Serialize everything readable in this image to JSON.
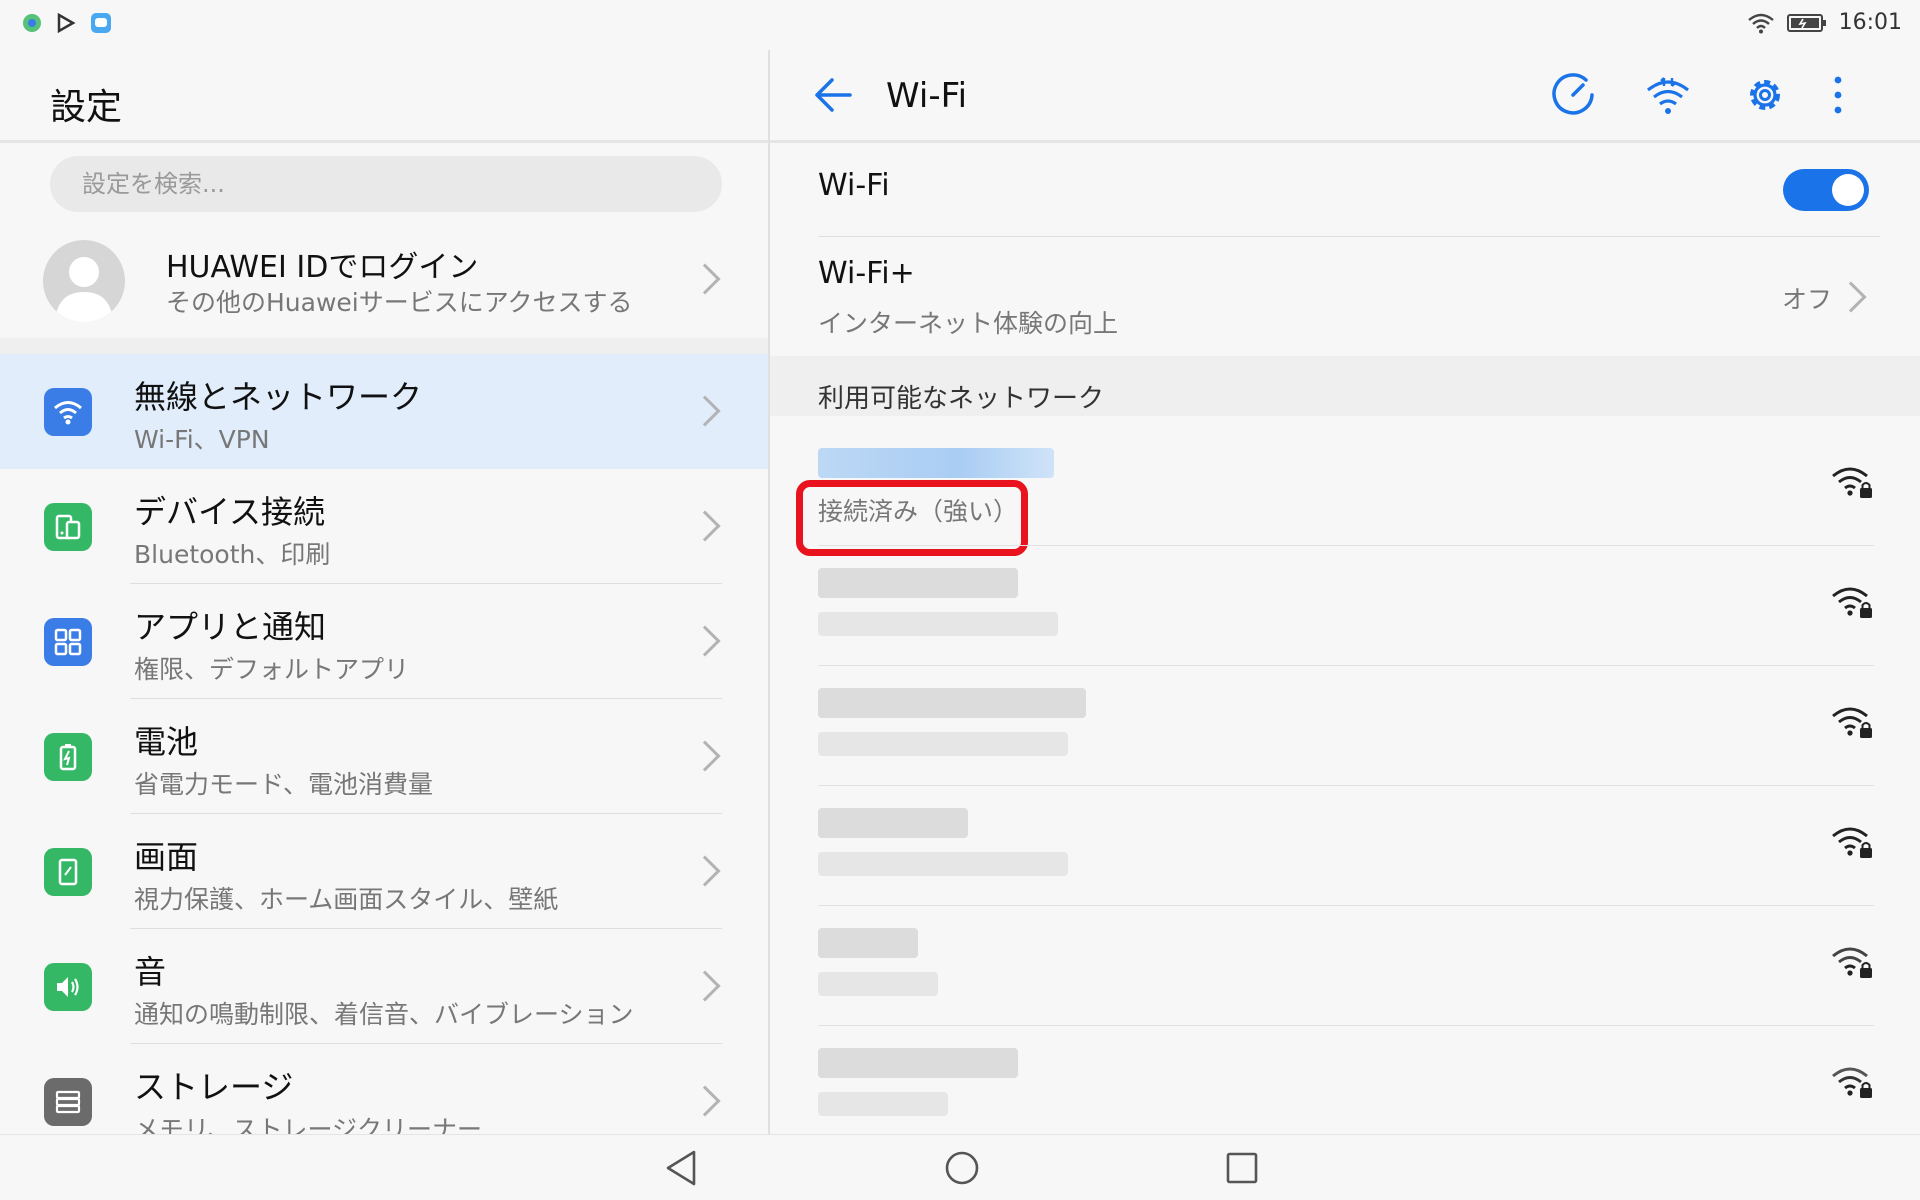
{
  "status_bar": {
    "time": "16:01"
  },
  "left": {
    "title": "設定",
    "search_placeholder": "設定を検索...",
    "account": {
      "title": "HUAWEI IDでログイン",
      "subtitle": "その他のHuaweiサービスにアクセスする"
    },
    "items": [
      {
        "title": "無線とネットワーク",
        "subtitle": "Wi-Fi、VPN",
        "icon": "wifi-icon",
        "color": "#3b7de6",
        "selected": true
      },
      {
        "title": "デバイス接続",
        "subtitle": "Bluetooth、印刷",
        "icon": "device-connect-icon",
        "color": "#35b865"
      },
      {
        "title": "アプリと通知",
        "subtitle": "権限、デフォルトアプリ",
        "icon": "apps-grid-icon",
        "color": "#3b7de6"
      },
      {
        "title": "電池",
        "subtitle": "省電力モード、電池消費量",
        "icon": "battery-icon",
        "color": "#35b865"
      },
      {
        "title": "画面",
        "subtitle": "視力保護、ホーム画面スタイル、壁紙",
        "icon": "display-icon",
        "color": "#35b865"
      },
      {
        "title": "音",
        "subtitle": "通知の鳴動制限、着信音、バイブレーション",
        "icon": "speaker-icon",
        "color": "#35b865"
      },
      {
        "title": "ストレージ",
        "subtitle": "メモリ、ストレージクリーナー",
        "icon": "storage-icon",
        "color": "#6b6b6b"
      }
    ]
  },
  "right": {
    "title": "Wi-Fi",
    "wifi_label": "Wi-Fi",
    "wifi_enabled": true,
    "wifi_plus": {
      "title": "Wi-Fi+",
      "subtitle": "インターネット体験の向上",
      "value": "オフ"
    },
    "available_label": "利用可能なネットワーク",
    "connected_status": "接続済み（強い）",
    "accent": "#1a73e8",
    "highlight_color": "#e8131e"
  }
}
